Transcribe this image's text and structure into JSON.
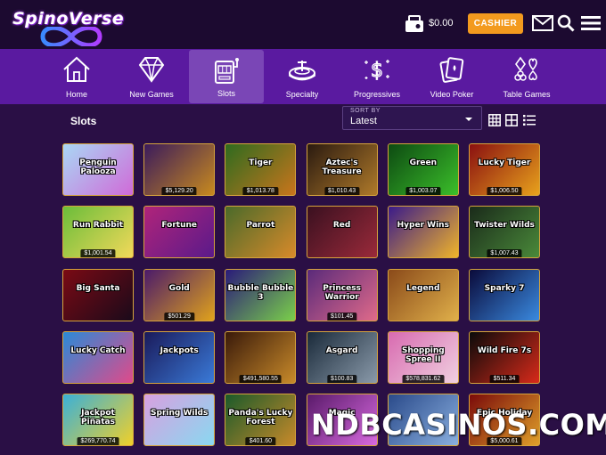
{
  "header": {
    "logo_text": "SpinoVerse",
    "balance": "$0.00",
    "cashier_label": "CASHIER"
  },
  "categories": [
    {
      "label": "Home",
      "icon": "home-icon"
    },
    {
      "label": "New Games",
      "icon": "diamond-icon"
    },
    {
      "label": "Slots",
      "icon": "slot-machine-icon",
      "active": true
    },
    {
      "label": "Specialty",
      "icon": "roulette-icon"
    },
    {
      "label": "Progressives",
      "icon": "dollar-sparkle-icon"
    },
    {
      "label": "Video Poker",
      "icon": "cards-icon"
    },
    {
      "label": "Table Games",
      "icon": "card-suits-icon"
    }
  ],
  "content": {
    "section_title": "Slots",
    "sort": {
      "caption": "SORT BY",
      "value": "Latest"
    }
  },
  "games": [
    {
      "name": "Penguin Palooza",
      "jackpot": "",
      "color1": "#a9d8f5",
      "color2": "#d06ad8"
    },
    {
      "name": "",
      "jackpot": "$5,129.20",
      "color1": "#3a1a5c",
      "color2": "#c88a1e"
    },
    {
      "name": "Tiger",
      "jackpot": "$1,013.78",
      "color1": "#2e6b1f",
      "color2": "#c9751c"
    },
    {
      "name": "Aztec's Treasure",
      "jackpot": "$1,010.43",
      "color1": "#2a1a10",
      "color2": "#b07a2a"
    },
    {
      "name": "Green",
      "jackpot": "$1,003.07",
      "color1": "#0d4a12",
      "color2": "#3bbf2a"
    },
    {
      "name": "Lucky Tiger",
      "jackpot": "$1,006.50",
      "color1": "#8a1010",
      "color2": "#e8a21c"
    },
    {
      "name": "Run Rabbit",
      "jackpot": "$1,001.54",
      "color1": "#6bbd3a",
      "color2": "#f2d95a"
    },
    {
      "name": "Fortune",
      "jackpot": "",
      "color1": "#b0247a",
      "color2": "#5a1a8a"
    },
    {
      "name": "Parrot",
      "jackpot": "",
      "color1": "#4a6a2a",
      "color2": "#d88a2a"
    },
    {
      "name": "Red",
      "jackpot": "",
      "color1": "#3a1020",
      "color2": "#9a2a3a"
    },
    {
      "name": "Hyper Wins",
      "jackpot": "",
      "color1": "#3a1a8a",
      "color2": "#f0b42a"
    },
    {
      "name": "Twister Wilds",
      "jackpot": "$1,007.43",
      "color1": "#1a2a1a",
      "color2": "#4a8a3a"
    },
    {
      "name": "Big Santa",
      "jackpot": "",
      "color1": "#7a0a14",
      "color2": "#1a0a1a"
    },
    {
      "name": "Gold",
      "jackpot": "$501.29",
      "color1": "#4a1a6a",
      "color2": "#e0a21c"
    },
    {
      "name": "Bubble Bubble 3",
      "jackpot": "",
      "color1": "#2a1a7a",
      "color2": "#7ad04a"
    },
    {
      "name": "Princess Warrior",
      "jackpot": "$101.45",
      "color1": "#5a2a7a",
      "color2": "#e06a8a"
    },
    {
      "name": "Legend",
      "jackpot": "",
      "color1": "#8a4a1a",
      "color2": "#e0b04a"
    },
    {
      "name": "Sparky 7",
      "jackpot": "",
      "color1": "#0a0a3a",
      "color2": "#3a8ae0"
    },
    {
      "name": "Lucky Catch",
      "jackpot": "",
      "color1": "#2a8ad8",
      "color2": "#e04a8a"
    },
    {
      "name": "Jackpots",
      "jackpot": "",
      "color1": "#1a1a5a",
      "color2": "#3a7ad8"
    },
    {
      "name": "",
      "jackpot": "$491,580.55",
      "color1": "#3a1a0a",
      "color2": "#c88a2a"
    },
    {
      "name": "Asgard",
      "jackpot": "$100.83",
      "color1": "#1a2a3a",
      "color2": "#8a9aaa"
    },
    {
      "name": "Shopping Spree II",
      "jackpot": "$578,831.62",
      "color1": "#d86ab0",
      "color2": "#f0d0e0"
    },
    {
      "name": "Wild Fire 7s",
      "jackpot": "$511.34",
      "color1": "#0a0a0a",
      "color2": "#d82a1a"
    },
    {
      "name": "Jackpot Piñatas",
      "jackpot": "$269,770.74",
      "color1": "#3ab0d8",
      "color2": "#f0d02a"
    },
    {
      "name": "Spring Wilds",
      "jackpot": "",
      "color1": "#d8a0e0",
      "color2": "#8ad8f0"
    },
    {
      "name": "Panda's Lucky Forest",
      "jackpot": "$401.60",
      "color1": "#1a5a2a",
      "color2": "#c88a2a"
    },
    {
      "name": "Magic",
      "jackpot": "",
      "color1": "#5a1a6a",
      "color2": "#d86ae0"
    },
    {
      "name": "",
      "jackpot": "",
      "color1": "#2a4a8a",
      "color2": "#8ab0e0"
    },
    {
      "name": "Epic Holiday",
      "jackpot": "$5,000.61",
      "color1": "#7a0a0a",
      "color2": "#e0a02a"
    }
  ],
  "watermark": "NDBCASINOS.COM",
  "colors": {
    "header_bg": "#1c0a30",
    "nav_bg": "#5a1aa0",
    "nav_active": "#7a46b6",
    "page_bg": "#2a0f45",
    "cashier": "#f39a1e",
    "tile_border": "#d6a43c"
  }
}
